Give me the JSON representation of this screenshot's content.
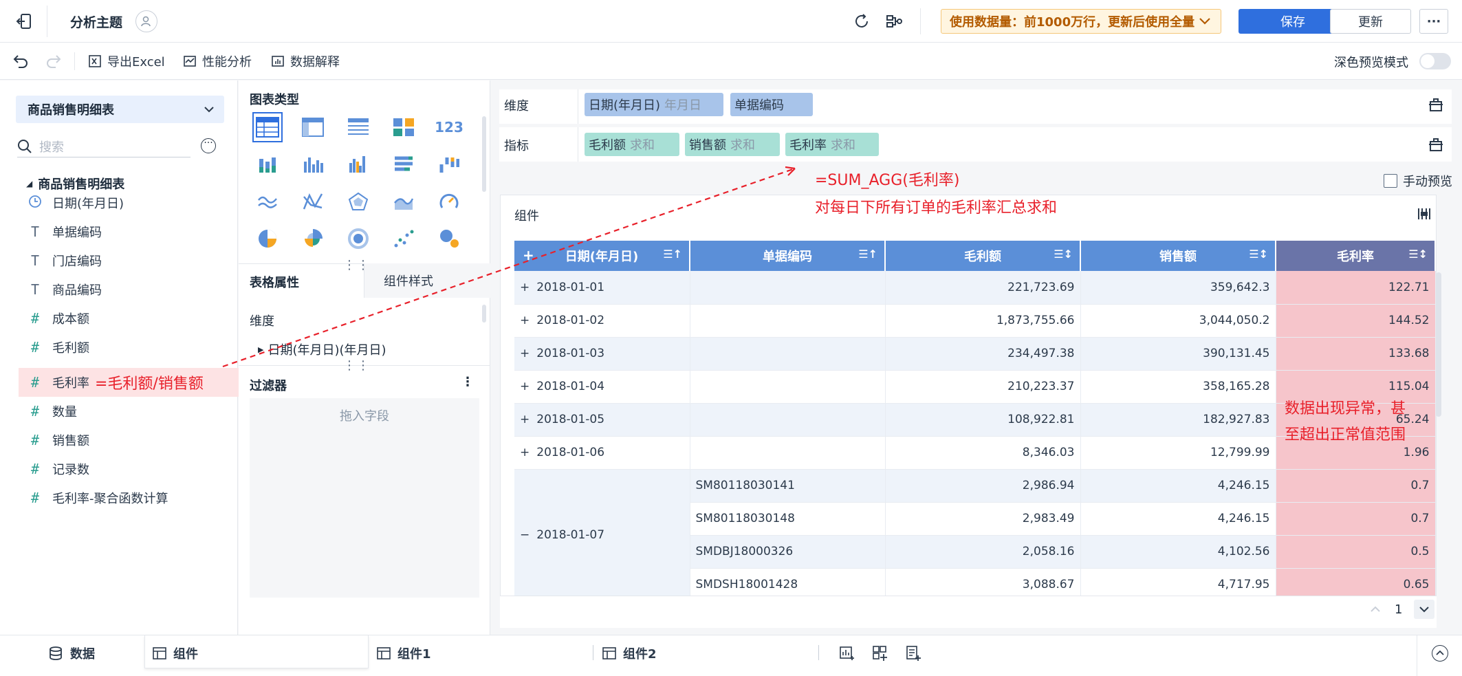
{
  "topbar": {
    "title": "分析主题",
    "usage_text": "使用数据量：前1000万行，更新后使用全量",
    "save_label": "保存",
    "update_label": "更新",
    "more_label": "···"
  },
  "toolbar": {
    "export_label": "导出Excel",
    "perf_label": "性能分析",
    "explain_label": "数据解释",
    "dark_mode_label": "深色预览模式"
  },
  "left": {
    "dataset_label": "商品销售明细表",
    "search_placeholder": "搜索",
    "tree_root": "商品销售明细表",
    "fields": [
      {
        "icon": "clock-icon",
        "label": "日期(年月日)"
      },
      {
        "icon": "text-field-icon",
        "label": "单据编码"
      },
      {
        "icon": "text-field-icon",
        "label": "门店编码"
      },
      {
        "icon": "text-field-icon",
        "label": "商品编码"
      },
      {
        "icon": "number-field-icon",
        "label": "成本额"
      },
      {
        "icon": "number-field-icon",
        "label": "毛利额"
      },
      {
        "icon": "number-field-icon",
        "label": "毛利率"
      },
      {
        "icon": "number-field-icon",
        "label": "数量"
      },
      {
        "icon": "number-field-icon",
        "label": "销售额"
      },
      {
        "icon": "number-field-icon",
        "label": "记录数"
      },
      {
        "icon": "calc-field-icon",
        "label": "毛利率-聚合函数计算"
      }
    ],
    "margin_formula": "=毛利额/销售额"
  },
  "middle": {
    "chart_type_title": "图表类型",
    "tab_table_props": "表格属性",
    "tab_component_style": "组件样式",
    "dimension_label": "维度",
    "dimension_item": "日期(年月日)(年月日)",
    "filter_title": "过滤器",
    "filter_placeholder": "拖入字段"
  },
  "right": {
    "dimension_label": "维度",
    "metric_label": "指标",
    "dim_pills": [
      {
        "label": "日期(年月日)",
        "sub": "年月日"
      },
      {
        "label": "单据编码",
        "sub": ""
      }
    ],
    "metric_pills": [
      {
        "label": "毛利额",
        "sub": "求和"
      },
      {
        "label": "销售额",
        "sub": "求和"
      },
      {
        "label": "毛利率",
        "sub": "求和"
      }
    ],
    "manual_preview_label": "手动预览",
    "component_label": "组件",
    "annotation_formula": "=SUM_AGG(毛利率)",
    "annotation_desc": "对每日下所有订单的毛利率汇总求和",
    "annotation_anomaly_1": "数据出现异常，甚",
    "annotation_anomaly_2": "至超出正常值范围",
    "page_number": "1"
  },
  "table": {
    "columns": [
      "日期(年月日)",
      "单据编码",
      "毛利额",
      "销售额",
      "毛利率"
    ],
    "rows": [
      {
        "expander": "+",
        "date": "2018-01-01",
        "code": "",
        "gross": "221,723.69",
        "sales": "359,642.3",
        "rate": "122.71"
      },
      {
        "expander": "+",
        "date": "2018-01-02",
        "code": "",
        "gross": "1,873,755.66",
        "sales": "3,044,050.2",
        "rate": "144.52"
      },
      {
        "expander": "+",
        "date": "2018-01-03",
        "code": "",
        "gross": "234,497.38",
        "sales": "390,131.45",
        "rate": "133.68"
      },
      {
        "expander": "+",
        "date": "2018-01-04",
        "code": "",
        "gross": "210,223.37",
        "sales": "358,165.28",
        "rate": "115.04"
      },
      {
        "expander": "+",
        "date": "2018-01-05",
        "code": "",
        "gross": "108,922.81",
        "sales": "182,927.83",
        "rate": "65.24"
      },
      {
        "expander": "+",
        "date": "2018-01-06",
        "code": "",
        "gross": "8,346.03",
        "sales": "12,799.99",
        "rate": "1.96"
      }
    ],
    "group": {
      "expander": "−",
      "date": "2018-01-07",
      "rows": [
        {
          "code": "SM80118030141",
          "gross": "2,986.94",
          "sales": "4,246.15",
          "rate": "0.7"
        },
        {
          "code": "SM80118030148",
          "gross": "2,983.49",
          "sales": "4,246.15",
          "rate": "0.7"
        },
        {
          "code": "SMDBJ18000326",
          "gross": "2,058.16",
          "sales": "4,102.56",
          "rate": "0.5"
        },
        {
          "code": "SMDSH18001428",
          "gross": "3,088.67",
          "sales": "4,717.95",
          "rate": "0.65"
        }
      ]
    }
  },
  "bottom": {
    "data_tab": "数据",
    "tabs": [
      "组件",
      "组件1",
      "组件2"
    ]
  },
  "colors": {
    "primary": "#2f6fde",
    "header_blue": "#5b8fd8",
    "highlight_red": "#f6c5cb",
    "annotation_red": "#e8202a",
    "teal": "#2a9d8f"
  }
}
